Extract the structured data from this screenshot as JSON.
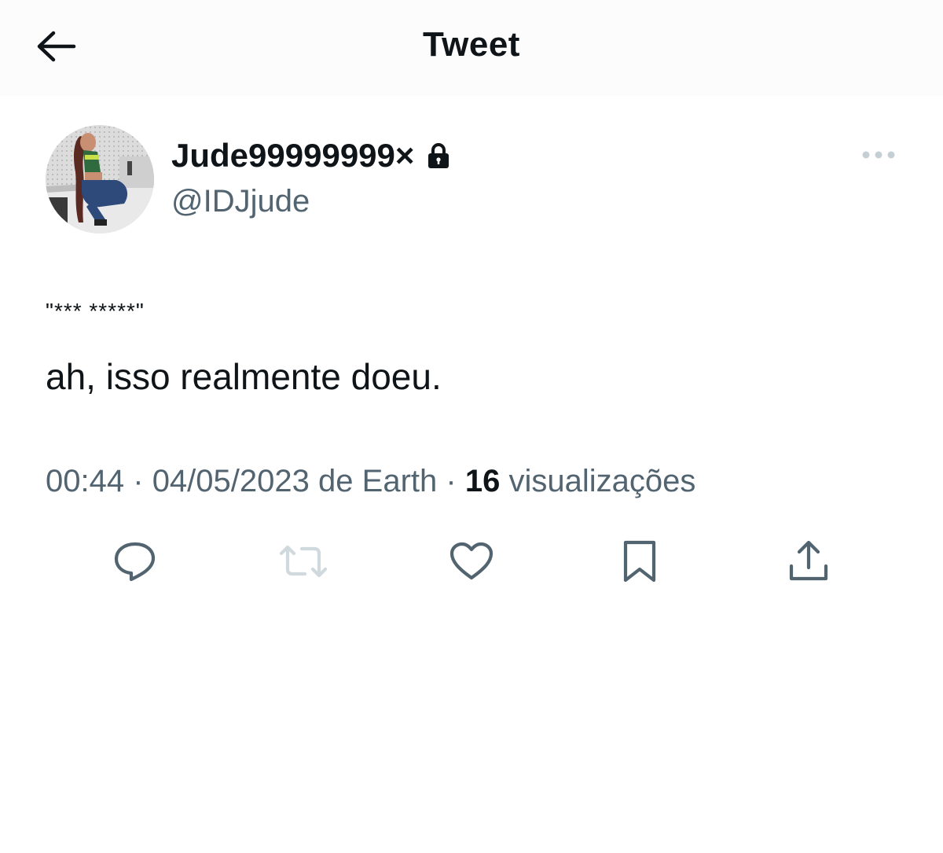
{
  "header": {
    "title": "Tweet",
    "back_icon": "arrow-left-icon"
  },
  "author": {
    "display_name": "Jude99999999×",
    "handle": "@IDJjude",
    "protected_icon": "lock-icon",
    "avatar": "profile-photo"
  },
  "tweet": {
    "quote": "\"*** *****\"",
    "text": "ah, isso realmente doeu.",
    "time": "00:44",
    "date": "04/05/2023",
    "source_prefix": "de",
    "source": "Earth",
    "separator": "·",
    "views_count": "16",
    "views_label": "visualizações"
  },
  "actions": [
    {
      "name": "reply",
      "icon": "reply-icon"
    },
    {
      "name": "retweet",
      "icon": "retweet-icon",
      "disabled": true
    },
    {
      "name": "like",
      "icon": "heart-icon"
    },
    {
      "name": "bookmark",
      "icon": "bookmark-icon"
    },
    {
      "name": "share",
      "icon": "share-icon"
    }
  ],
  "colors": {
    "text_primary": "#0f1419",
    "text_secondary": "#536471",
    "icon_secondary": "#536471",
    "icon_disabled": "#cfd9de",
    "background": "#ffffff",
    "header_background": "#fcfcfc"
  }
}
